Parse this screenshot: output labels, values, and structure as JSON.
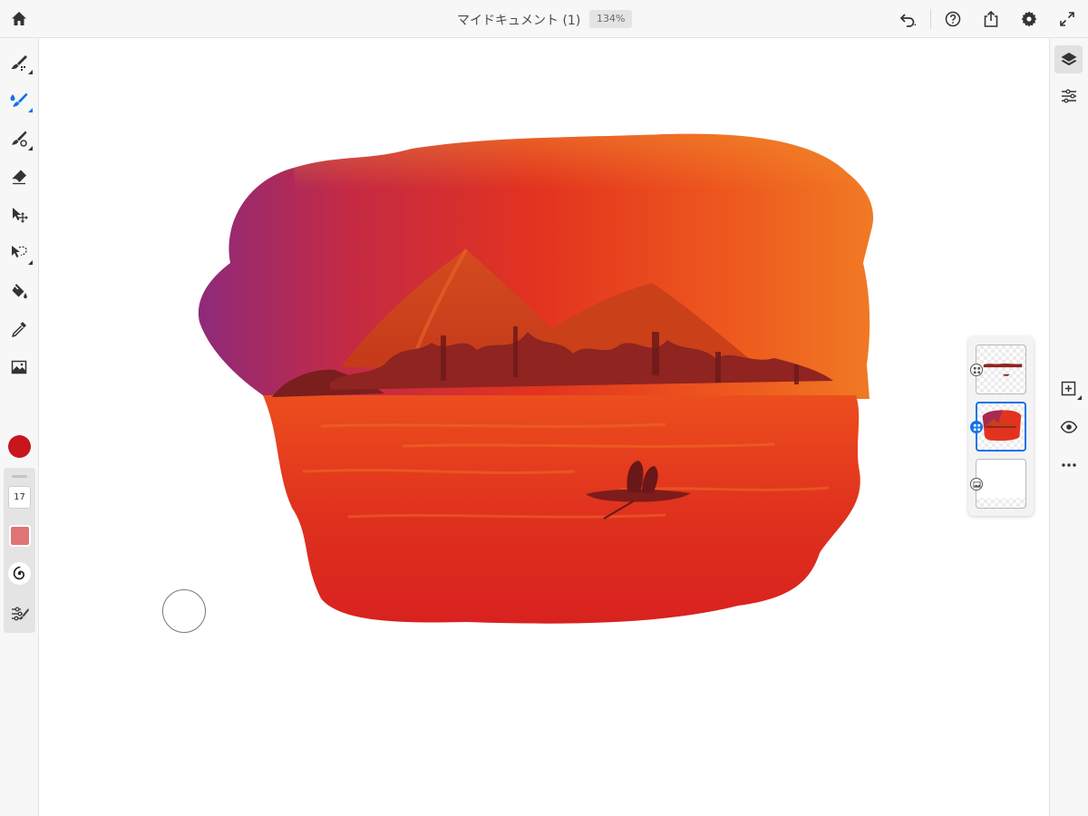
{
  "app": {
    "document_title": "マイドキュメント (1)",
    "zoom": "134%"
  },
  "topbar": {
    "left_icons": [
      "home-icon"
    ],
    "right_icons": [
      "undo-icon",
      "help-icon",
      "share-icon",
      "settings-icon",
      "fullscreen-icon"
    ]
  },
  "toolbar": {
    "tools": [
      {
        "name": "pixel-brush-tool",
        "icon": "pixel-brush-icon",
        "active": false
      },
      {
        "name": "live-brush-tool",
        "icon": "watercolor-brush-icon",
        "active": true
      },
      {
        "name": "vector-brush-tool",
        "icon": "vector-brush-icon",
        "active": false
      },
      {
        "name": "eraser-tool",
        "icon": "eraser-icon",
        "active": false
      },
      {
        "name": "transform-tool",
        "icon": "transform-icon",
        "active": false
      },
      {
        "name": "selection-tool",
        "icon": "lasso-icon",
        "active": false
      },
      {
        "name": "fill-tool",
        "icon": "paint-bucket-icon",
        "active": false
      },
      {
        "name": "eyedropper-tool",
        "icon": "eyedropper-icon",
        "active": false
      },
      {
        "name": "place-image-tool",
        "icon": "image-icon",
        "active": false
      }
    ],
    "active_color": "#c8161d"
  },
  "brush_properties": {
    "size": "17",
    "opacity_color": "#e07477",
    "flow_icon": "spiral-icon",
    "settings_icon": "brush-settings-icon"
  },
  "right_rail": {
    "buttons": [
      {
        "name": "layers-button",
        "icon": "layers-icon",
        "active": true
      },
      {
        "name": "layer-properties-button",
        "icon": "sliders-icon",
        "active": false
      },
      {
        "name": "add-layer-button",
        "icon": "add-layer-icon",
        "active": false
      },
      {
        "name": "toggle-visibility-button",
        "icon": "eye-icon",
        "active": false
      },
      {
        "name": "more-options-button",
        "icon": "more-icon",
        "active": false
      }
    ]
  },
  "layers": [
    {
      "name": "layer-pixel-top",
      "type": "pixel",
      "selected": false
    },
    {
      "name": "layer-live-paint",
      "type": "live",
      "selected": true
    },
    {
      "name": "layer-image",
      "type": "image",
      "selected": false
    }
  ],
  "colors": {
    "accent": "#1473e6",
    "toolbar_bg": "#f7f7f7"
  }
}
